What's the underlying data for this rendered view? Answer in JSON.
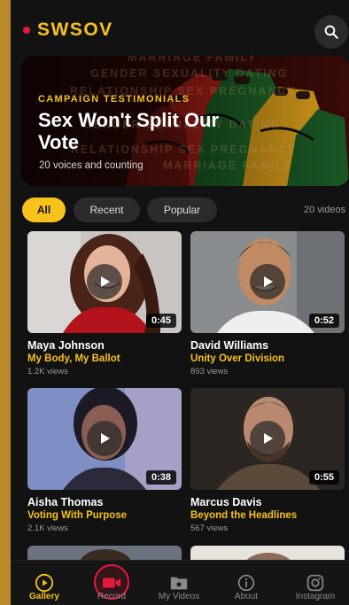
{
  "app": {
    "logo": "SWSOV",
    "accent": "#f6c21b",
    "live_dot": "#e31b3b"
  },
  "header": {
    "search_icon": "search-icon"
  },
  "hero": {
    "kicker": "CAMPAIGN TESTIMONIALS",
    "title": "Sex Won't Split Our Vote",
    "subtitle": "20 voices and counting",
    "background_words": [
      "MARRIAGE FAMILY",
      "GENDER SEXUALITY DATING",
      "RELATIONSHIP SEX PREGNANCY",
      "GENDER SEXUALITY DATING",
      "RELATIONSHIP SEX PREGNANCY",
      "MARRIAGE FAMILY"
    ]
  },
  "filters": {
    "chips": [
      {
        "label": "All",
        "active": true
      },
      {
        "label": "Recent",
        "active": false
      },
      {
        "label": "Popular",
        "active": false
      }
    ],
    "count_label": "20 videos"
  },
  "videos": [
    {
      "name": "Maya Johnson",
      "topic": "My Body, My Ballot",
      "views": "1.2K views",
      "duration": "0:45"
    },
    {
      "name": "David Williams",
      "topic": "Unity Over Division",
      "views": "893 views",
      "duration": "0:52"
    },
    {
      "name": "Aisha Thomas",
      "topic": "Voting With Purpose",
      "views": "2.1K views",
      "duration": "0:38"
    },
    {
      "name": "Marcus Davis",
      "topic": "Beyond the Headlines",
      "views": "567 views",
      "duration": "0:55"
    }
  ],
  "nav": {
    "items": [
      {
        "label": "Gallery",
        "icon": "play-circle-icon",
        "active": true
      },
      {
        "label": "Record",
        "icon": "video-camera-icon",
        "active": false
      },
      {
        "label": "My Videos",
        "icon": "folder-star-icon",
        "active": false
      },
      {
        "label": "About",
        "icon": "info-icon",
        "active": false
      },
      {
        "label": "Instagram",
        "icon": "instagram-icon",
        "active": false
      }
    ]
  }
}
